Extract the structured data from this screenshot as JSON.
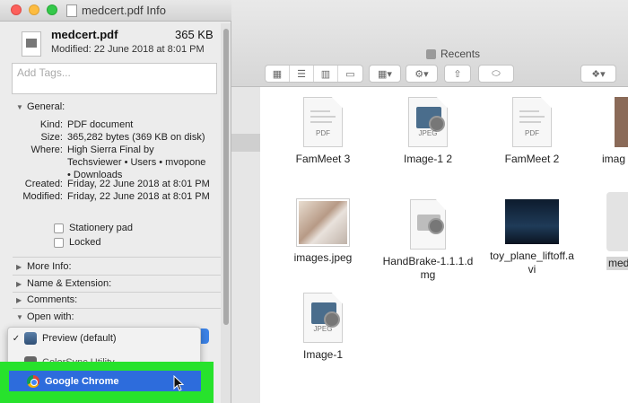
{
  "info_window": {
    "title": "medcert.pdf Info",
    "file_name": "medcert.pdf",
    "file_size": "365 KB",
    "modified_short": "Modified: 22 June 2018 at 8:01 PM",
    "tags_placeholder": "Add Tags...",
    "general_header": "General:",
    "general": {
      "kind_key": "Kind:",
      "kind_val": "PDF document",
      "size_key": "Size:",
      "size_val": "365,282 bytes (369 KB on disk)",
      "where_key": "Where:",
      "where_val1": "High Sierra Final by",
      "where_val2": "Techsviewer • Users • mvopone",
      "where_val3": "• Downloads",
      "created_key": "Created:",
      "created_val": "Friday, 22 June 2018 at 8:01 PM",
      "modified_key": "Modified:",
      "modified_val": "Friday, 22 June 2018 at 8:01 PM"
    },
    "stationery_label": "Stationery pad",
    "locked_label": "Locked",
    "sections": [
      "More Info:",
      "Name & Extension:",
      "Comments:",
      "Open with:"
    ],
    "menu": {
      "item1": "Preview (default)",
      "item2": "ColorSync Utility",
      "selected": "Google Chrome",
      "check": "✓"
    }
  },
  "finder": {
    "title": "Recents",
    "files": [
      {
        "name": "FamMeet 3",
        "ext": "PDF"
      },
      {
        "name": "Image-1 2",
        "ext": "JPEG"
      },
      {
        "name": "FamMeet 2",
        "ext": "PDF"
      },
      {
        "name": "imag"
      },
      {
        "name": "images.jpeg"
      },
      {
        "name": "HandBrake-1.1.1.d",
        "name2": "mg"
      },
      {
        "name": "toy_plane_liftoff.a",
        "name2": "vi"
      },
      {
        "name": "med"
      },
      {
        "name": "Image-1",
        "ext": "JPEG"
      }
    ]
  },
  "colors": {
    "highlight_green": "#27e22c",
    "selection_blue": "#2d6cdc"
  }
}
